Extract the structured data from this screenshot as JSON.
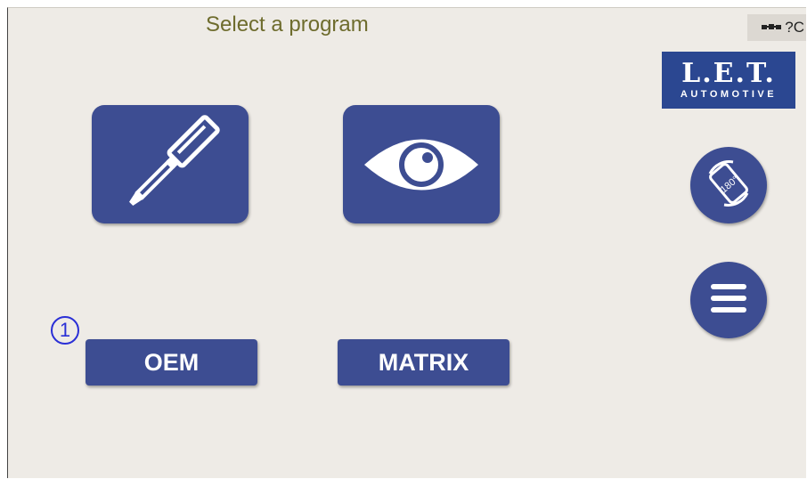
{
  "header": {
    "title": "Select a program",
    "status_text": "?C",
    "status_icon": "vehicle-icon"
  },
  "logo": {
    "main": "L.E.T.",
    "sub": "AUTOMOTIVE"
  },
  "tiles": [
    {
      "icon": "screwdriver-icon"
    },
    {
      "icon": "eye-icon"
    }
  ],
  "side_buttons": [
    {
      "icon": "rotate-180-icon",
      "label": "180°"
    },
    {
      "icon": "menu-icon"
    }
  ],
  "buttons": {
    "oem": "OEM",
    "matrix": "MATRIX"
  },
  "annotation": {
    "marker": "1"
  },
  "colors": {
    "background": "#eeebe6",
    "button": "#3d4d92",
    "title": "#6e6c2d",
    "logo": "#2b4791",
    "marker": "#2a2fd6"
  }
}
